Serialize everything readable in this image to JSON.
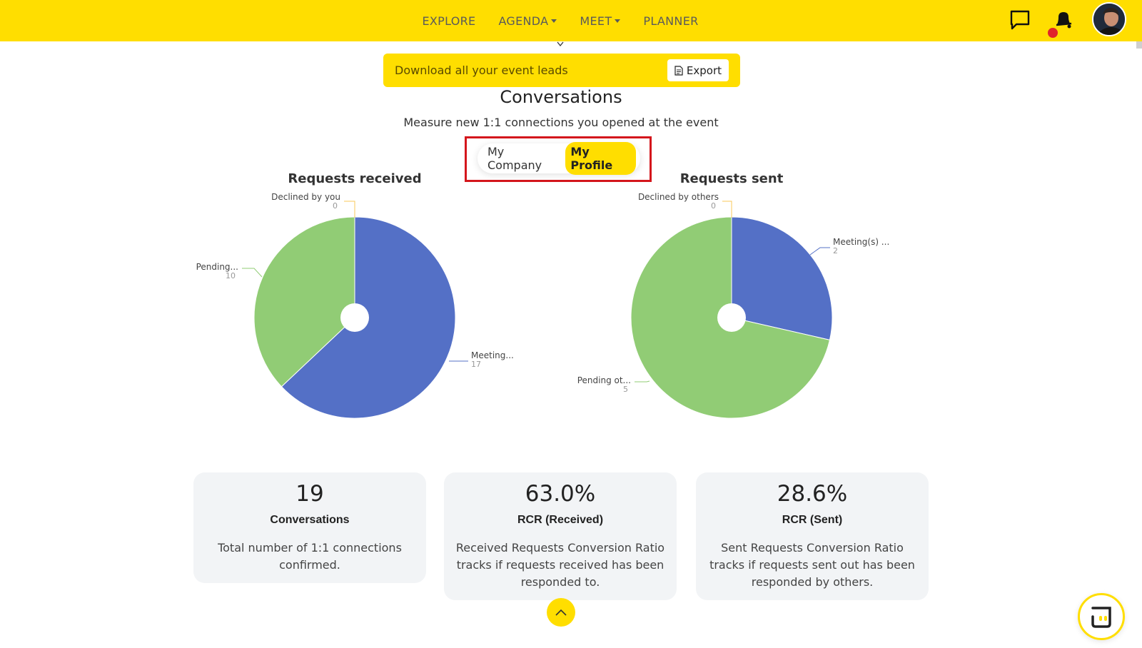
{
  "nav": {
    "items": [
      {
        "label": "EXPLORE",
        "dropdown": false
      },
      {
        "label": "AGENDA",
        "dropdown": true
      },
      {
        "label": "MEET",
        "dropdown": true
      },
      {
        "label": "PLANNER",
        "dropdown": false
      }
    ],
    "icons": [
      "chat-icon",
      "bell-icon",
      "avatar"
    ]
  },
  "banner": {
    "text": "Download all your event leads",
    "export_label": "Export"
  },
  "section": {
    "title": "Conversations",
    "subtitle": "Measure new 1:1 connections you opened at the event"
  },
  "toggle": {
    "options": [
      "My Company",
      "My Profile"
    ],
    "selected": "My Profile"
  },
  "chart_data": [
    {
      "type": "pie",
      "title": "Requests received",
      "slices": [
        {
          "label": "Meeting...",
          "value": 17,
          "color": "#5470c6"
        },
        {
          "label": "Pending...",
          "value": 10,
          "color": "#91cc75"
        },
        {
          "label": "Declined by you",
          "value": 0,
          "color": "#fac858"
        }
      ]
    },
    {
      "type": "pie",
      "title": "Requests sent",
      "slices": [
        {
          "label": "Meeting(s) ...",
          "value": 2,
          "color": "#5470c6"
        },
        {
          "label": "Pending ot...",
          "value": 5,
          "color": "#91cc75"
        },
        {
          "label": "Declined by others",
          "value": 0,
          "color": "#fac858"
        }
      ]
    }
  ],
  "cards": [
    {
      "value": "19",
      "title": "Conversations",
      "desc": "Total number of 1:1 connections confirmed."
    },
    {
      "value": "63.0%",
      "title": "RCR (Received)",
      "desc": "Received Requests Conversion Ratio tracks if requests received has been responded to."
    },
    {
      "value": "28.6%",
      "title": "RCR (Sent)",
      "desc": "Sent Requests Conversion Ratio tracks if requests sent out has been responded by others."
    }
  ],
  "colors": {
    "accent": "#ffde00",
    "highlight": "#d4161c",
    "meeting": "#5470c6",
    "pending": "#91cc75",
    "declined": "#fac858",
    "notification": "#e0242b"
  }
}
